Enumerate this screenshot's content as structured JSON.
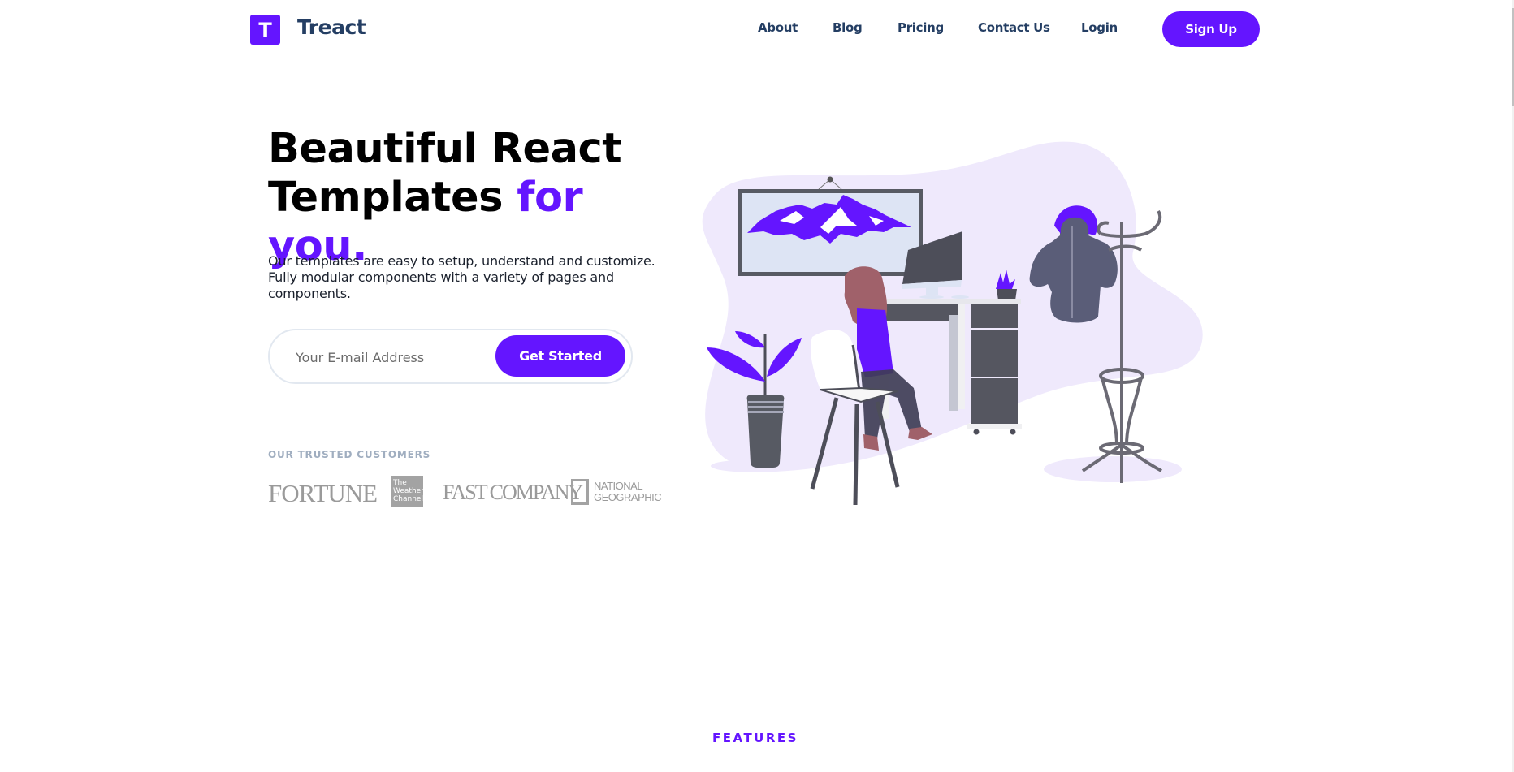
{
  "brand": {
    "logo_letter": "T",
    "name": "Treact"
  },
  "nav": {
    "links": [
      "About",
      "Blog",
      "Pricing",
      "Contact Us",
      "Login"
    ],
    "cta": "Sign Up"
  },
  "hero": {
    "title_line1": "Beautiful React",
    "title_line2": "Templates",
    "title_accent": "for you.",
    "description": "Our templates are easy to setup, understand and customize. Fully modular components with a variety of pages and components.",
    "email_placeholder": "Your E-mail Address",
    "email_value": "",
    "cta": "Get Started"
  },
  "customers": {
    "label": "OUR TRUSTED CUSTOMERS",
    "logos": [
      "FORTUNE",
      "The Weather Channel",
      "FAST COMPANY",
      "NATIONAL GEOGRAPHIC"
    ],
    "fortune": "FORTUNE",
    "weather_l1": "The",
    "weather_l2": "Weather",
    "weather_l3": "Channel",
    "fastco": "FAST COMPANY",
    "natgeo_l1": "NATIONAL",
    "natgeo_l2": "GEOGRAPHIC"
  },
  "illustration": {
    "subject": "person-working-at-desk"
  },
  "next_section": {
    "label": "FEATURES"
  },
  "colors": {
    "primary": "#6415ff",
    "heading": "#243e63",
    "muted": "#a0aec0",
    "blob": "#efe9fc"
  }
}
